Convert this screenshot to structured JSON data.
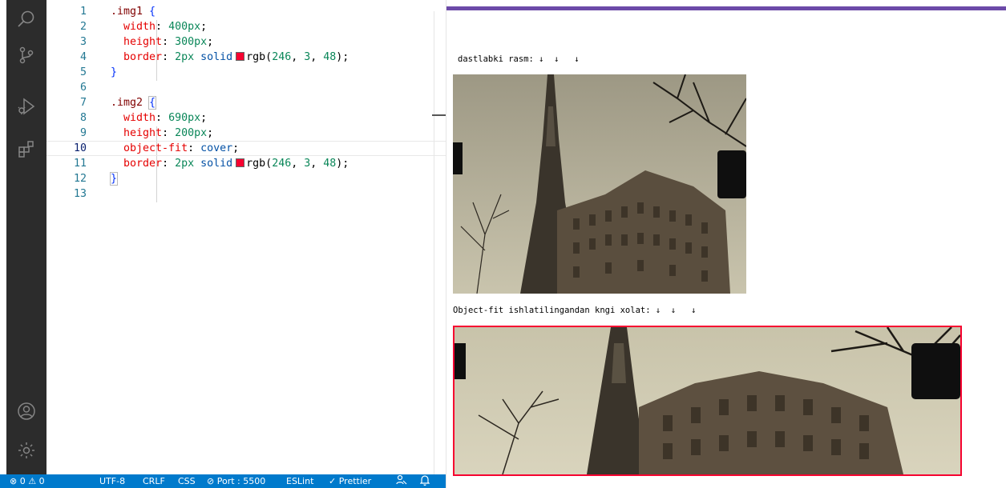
{
  "editor": {
    "lines": [
      {
        "n": "1",
        "tokens": [
          {
            "c": "tk-sel",
            "t": ".img1"
          },
          {
            "c": "tk-plain",
            "t": " "
          },
          {
            "c": "tk-brace",
            "t": "{"
          }
        ]
      },
      {
        "n": "2",
        "tokens": [
          {
            "c": "tk-plain",
            "t": "  "
          },
          {
            "c": "tk-prop",
            "t": "width"
          },
          {
            "c": "tk-plain",
            "t": ": "
          },
          {
            "c": "tk-val",
            "t": "400px"
          },
          {
            "c": "tk-plain",
            "t": ";"
          }
        ]
      },
      {
        "n": "3",
        "tokens": [
          {
            "c": "tk-plain",
            "t": "  "
          },
          {
            "c": "tk-prop",
            "t": "height"
          },
          {
            "c": "tk-plain",
            "t": ": "
          },
          {
            "c": "tk-val",
            "t": "300px"
          },
          {
            "c": "tk-plain",
            "t": ";"
          }
        ]
      },
      {
        "n": "4",
        "tokens": [
          {
            "c": "tk-plain",
            "t": "  "
          },
          {
            "c": "tk-prop",
            "t": "border"
          },
          {
            "c": "tk-plain",
            "t": ": "
          },
          {
            "c": "tk-val",
            "t": "2px"
          },
          {
            "c": "tk-plain",
            "t": " "
          },
          {
            "c": "tk-kw",
            "t": "solid"
          },
          {
            "c": "swatch",
            "t": ""
          },
          {
            "c": "tk-plain",
            "t": "rgb("
          },
          {
            "c": "tk-val",
            "t": "246"
          },
          {
            "c": "tk-plain",
            "t": ", "
          },
          {
            "c": "tk-val",
            "t": "3"
          },
          {
            "c": "tk-plain",
            "t": ", "
          },
          {
            "c": "tk-val",
            "t": "48"
          },
          {
            "c": "tk-plain",
            "t": ");"
          }
        ]
      },
      {
        "n": "5",
        "tokens": [
          {
            "c": "tk-brace",
            "t": "}"
          }
        ]
      },
      {
        "n": "6",
        "tokens": []
      },
      {
        "n": "7",
        "tokens": [
          {
            "c": "tk-sel",
            "t": ".img2"
          },
          {
            "c": "tk-plain",
            "t": " "
          },
          {
            "c": "tk-brace tk-brace-box",
            "t": "{"
          }
        ]
      },
      {
        "n": "8",
        "tokens": [
          {
            "c": "tk-plain",
            "t": "  "
          },
          {
            "c": "tk-prop",
            "t": "width"
          },
          {
            "c": "tk-plain",
            "t": ": "
          },
          {
            "c": "tk-val",
            "t": "690px"
          },
          {
            "c": "tk-plain",
            "t": ";"
          }
        ]
      },
      {
        "n": "9",
        "tokens": [
          {
            "c": "tk-plain",
            "t": "  "
          },
          {
            "c": "tk-prop",
            "t": "height"
          },
          {
            "c": "tk-plain",
            "t": ": "
          },
          {
            "c": "tk-val",
            "t": "200px"
          },
          {
            "c": "tk-plain",
            "t": ";"
          }
        ]
      },
      {
        "n": "10",
        "tokens": [
          {
            "c": "tk-plain",
            "t": "  "
          },
          {
            "c": "tk-prop",
            "t": "object-fit"
          },
          {
            "c": "tk-plain",
            "t": ": "
          },
          {
            "c": "tk-kw",
            "t": "cover"
          },
          {
            "c": "tk-plain",
            "t": ";"
          }
        ]
      },
      {
        "n": "11",
        "tokens": [
          {
            "c": "tk-plain",
            "t": "  "
          },
          {
            "c": "tk-prop",
            "t": "border"
          },
          {
            "c": "tk-plain",
            "t": ": "
          },
          {
            "c": "tk-val",
            "t": "2px"
          },
          {
            "c": "tk-plain",
            "t": " "
          },
          {
            "c": "tk-kw",
            "t": "solid"
          },
          {
            "c": "swatch",
            "t": ""
          },
          {
            "c": "tk-plain",
            "t": "rgb("
          },
          {
            "c": "tk-val",
            "t": "246"
          },
          {
            "c": "tk-plain",
            "t": ", "
          },
          {
            "c": "tk-val",
            "t": "3"
          },
          {
            "c": "tk-plain",
            "t": ", "
          },
          {
            "c": "tk-val",
            "t": "48"
          },
          {
            "c": "tk-plain",
            "t": ");"
          }
        ]
      },
      {
        "n": "12",
        "tokens": [
          {
            "c": "tk-brace tk-brace-box",
            "t": "}"
          }
        ]
      },
      {
        "n": "13",
        "tokens": []
      }
    ],
    "active_line": "10",
    "swatch_color": "#f60330"
  },
  "activity_bar": {
    "icons": [
      "search-icon",
      "source-control-icon",
      "run-debug-icon",
      "extensions-icon",
      "account-icon",
      "settings-gear-icon"
    ]
  },
  "status_bar": {
    "errors": "0",
    "warnings": "0",
    "encoding": "UTF-8",
    "eol": "CRLF",
    "language": "CSS",
    "port": "Port : 5500",
    "eslint": "ESLint",
    "prettier": "Prettier"
  },
  "preview": {
    "caption1": "dastlabki rasm: ↓  ↓   ↓",
    "caption2": "Object-fit ishlatilingandan kngi xolat: ↓  ↓   ↓",
    "image_description": "eiffel-tower-street-photo",
    "border_color": "#f60330",
    "accent_color": "#6c4aa8"
  }
}
